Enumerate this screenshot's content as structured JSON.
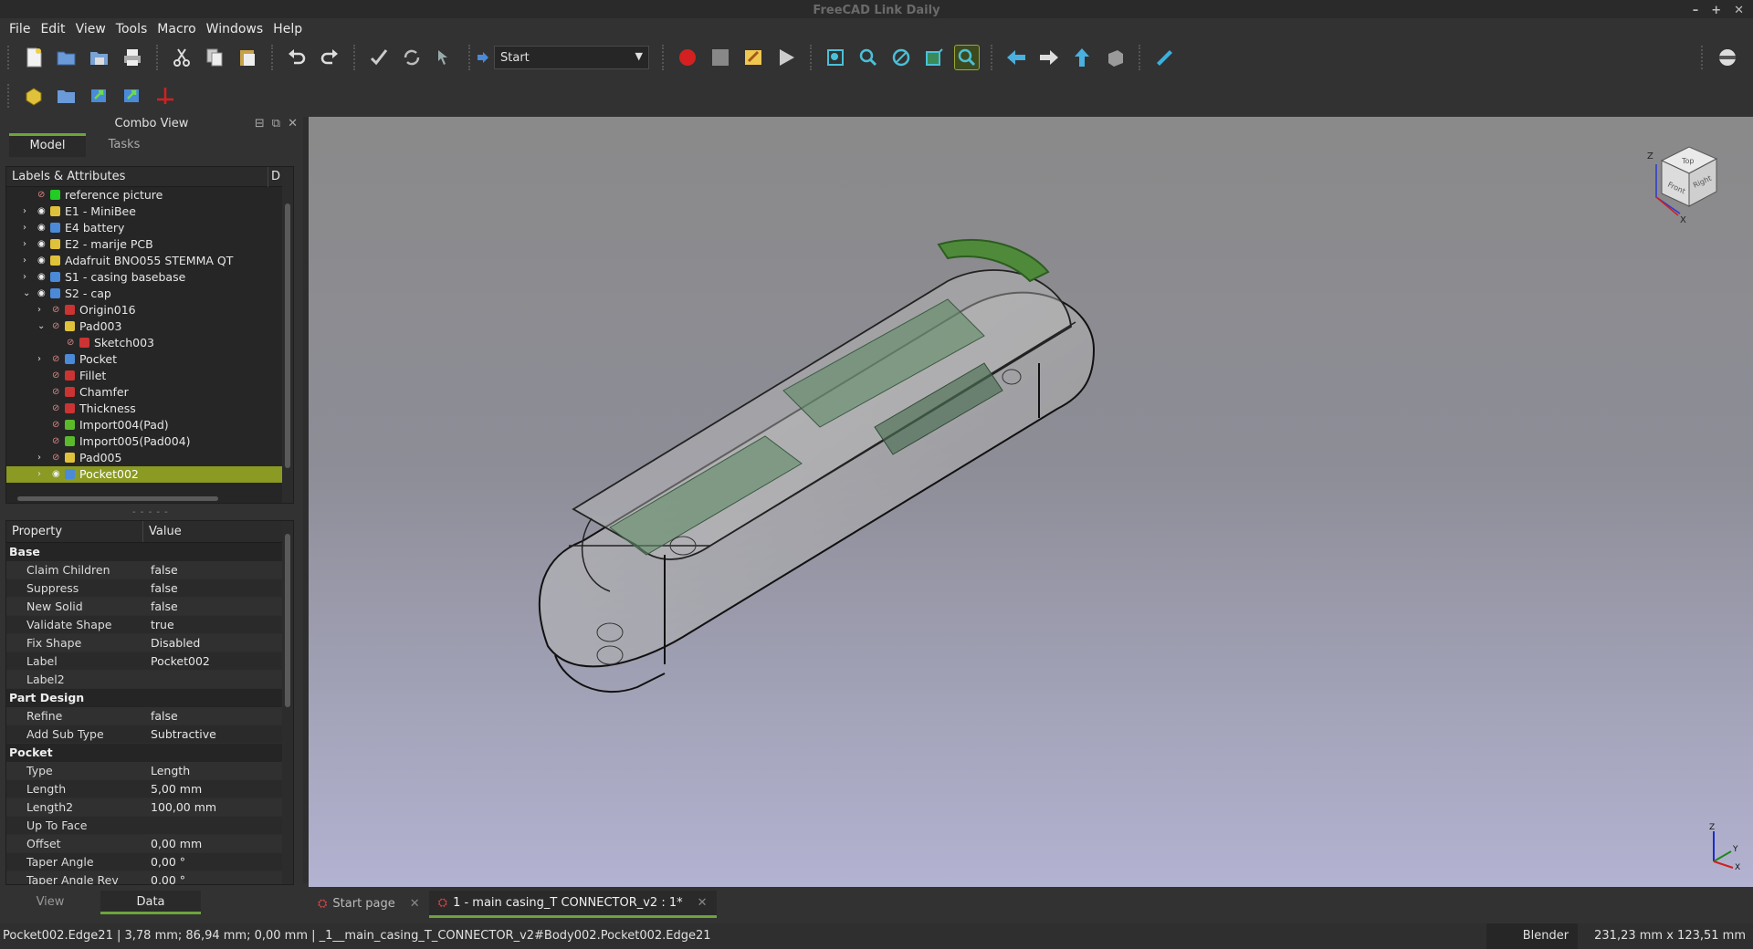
{
  "window": {
    "title": "FreeCAD Link Daily"
  },
  "menu": [
    "File",
    "Edit",
    "View",
    "Tools",
    "Macro",
    "Windows",
    "Help"
  ],
  "macro": {
    "selected": "Start"
  },
  "combo_view": {
    "title": "Combo View",
    "tabs": [
      "Model",
      "Tasks"
    ],
    "tree_header": "Labels & Attributes",
    "tree_header_right": "D",
    "tree": [
      {
        "label": "reference picture",
        "level": 1,
        "expander": "",
        "visible": false,
        "icon_color": "#22cc22"
      },
      {
        "label": "E1 - MiniBee",
        "level": 1,
        "expander": "›",
        "visible": true,
        "icon_color": "#e0c23a"
      },
      {
        "label": "E4 battery",
        "level": 1,
        "expander": "›",
        "visible": true,
        "icon_color": "#4a8ad8"
      },
      {
        "label": "E2 - marije PCB",
        "level": 1,
        "expander": "›",
        "visible": true,
        "icon_color": "#e0c23a"
      },
      {
        "label": "Adafruit BNO055 STEMMA QT",
        "level": 1,
        "expander": "›",
        "visible": true,
        "icon_color": "#e0c23a"
      },
      {
        "label": "S1 - casing basebase",
        "level": 1,
        "expander": "›",
        "visible": true,
        "icon_color": "#4a8ad8"
      },
      {
        "label": "S2 - cap",
        "level": 1,
        "expander": "⌄",
        "visible": true,
        "icon_color": "#4a8ad8"
      },
      {
        "label": "Origin016",
        "level": 2,
        "expander": "›",
        "visible": false,
        "icon_color": "#cc3333"
      },
      {
        "label": "Pad003",
        "level": 2,
        "expander": "⌄",
        "visible": false,
        "icon_color": "#e0c23a"
      },
      {
        "label": "Sketch003",
        "level": 3,
        "expander": "",
        "visible": false,
        "icon_color": "#cc3333"
      },
      {
        "label": "Pocket",
        "level": 2,
        "expander": "›",
        "visible": false,
        "icon_color": "#4a8ad8"
      },
      {
        "label": "Fillet",
        "level": 2,
        "expander": "",
        "visible": false,
        "icon_color": "#cc3333"
      },
      {
        "label": "Chamfer",
        "level": 2,
        "expander": "",
        "visible": false,
        "icon_color": "#cc3333"
      },
      {
        "label": "Thickness",
        "level": 2,
        "expander": "",
        "visible": false,
        "icon_color": "#cc3333"
      },
      {
        "label": "Import004(Pad)",
        "level": 2,
        "expander": "",
        "visible": false,
        "icon_color": "#5aba2a"
      },
      {
        "label": "Import005(Pad004)",
        "level": 2,
        "expander": "",
        "visible": false,
        "icon_color": "#5aba2a"
      },
      {
        "label": "Pad005",
        "level": 2,
        "expander": "›",
        "visible": false,
        "icon_color": "#e0c23a"
      },
      {
        "label": "Pocket002",
        "level": 2,
        "expander": "›",
        "visible": true,
        "icon_color": "#4a8ad8",
        "selected": true
      }
    ],
    "properties": {
      "header": [
        "Property",
        "Value"
      ],
      "groups": [
        {
          "name": "Base",
          "rows": [
            [
              "Claim Children",
              "false"
            ],
            [
              "Suppress",
              "false"
            ],
            [
              "New Solid",
              "false"
            ],
            [
              "Validate Shape",
              "true"
            ],
            [
              "Fix Shape",
              "Disabled"
            ],
            [
              "Label",
              "Pocket002"
            ],
            [
              "Label2",
              ""
            ]
          ]
        },
        {
          "name": "Part Design",
          "rows": [
            [
              "Refine",
              "false"
            ],
            [
              "Add Sub Type",
              "Subtractive"
            ]
          ]
        },
        {
          "name": "Pocket",
          "rows": [
            [
              "Type",
              "Length"
            ],
            [
              "Length",
              "5,00 mm"
            ],
            [
              "Length2",
              "100,00 mm"
            ],
            [
              "Up To Face",
              ""
            ],
            [
              "Offset",
              "0,00 mm"
            ],
            [
              "Taper Angle",
              "0,00 °"
            ],
            [
              "Taper Angle Rev",
              "0,00 °"
            ]
          ]
        }
      ]
    },
    "bottom_tabs": [
      "View",
      "Data"
    ]
  },
  "nav_cube": {
    "faces": [
      "Top",
      "Front",
      "Right"
    ],
    "axis_labels": [
      "Z",
      "X"
    ]
  },
  "axis_cross": {
    "labels": [
      "Z",
      "Y",
      "X"
    ]
  },
  "documents": [
    {
      "label": "Start page",
      "selected": false
    },
    {
      "label": "1 - main casing_T CONNECTOR_v2 : 1*",
      "selected": true
    }
  ],
  "status": {
    "left": "Pocket002.Edge21 | 3,78 mm; 86,94 mm; 0,00 mm | _1__main_casing_T_CONNECTOR_v2#Body002.Pocket002.Edge21",
    "nav_style": "Blender",
    "dimensions": "231,23 mm x 123,51 mm"
  },
  "colors": {
    "accent": "#6da43b",
    "selection": "#8a9a22",
    "viewport_top": "#8a8a8a",
    "viewport_bottom": "#b3b3d2"
  }
}
